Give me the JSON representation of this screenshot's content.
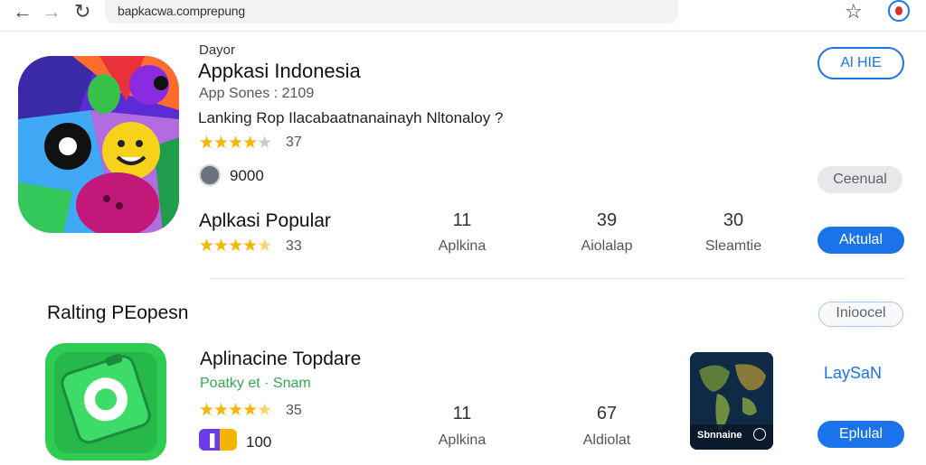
{
  "browser": {
    "url": "bapkacwa.comprepung",
    "back_icon": "arrow-left-icon",
    "forward_icon": "arrow-right-icon",
    "reload_icon": "reload-icon",
    "bookmark_icon": "star-icon"
  },
  "app1": {
    "developer": "Dayor",
    "name": "Appkasi Indonesia",
    "meta": "App Sones : 2109",
    "tagline": "Lanking Rop Ilacabaatnanainayh Nltonaloy ?",
    "rating_count": "37",
    "rating_stars": 3.5,
    "install_value": "9000",
    "action_top": "Al HIE",
    "action_secondary": "Ceenual"
  },
  "popular1": {
    "title": "Aplkasi Popular",
    "rating_count": "33",
    "rating_stars": 4.5,
    "stats": [
      {
        "value": "11",
        "label": "Aplkina"
      },
      {
        "value": "39",
        "label": "Aiolalap"
      },
      {
        "value": "30",
        "label": "Sleamtie"
      }
    ],
    "action": "Aktulal"
  },
  "section2": {
    "title": "Ralting PEopesn",
    "action": "Inioocel"
  },
  "app2": {
    "name": "Aplinacine Topdare",
    "meta": "Poatky et · Snam",
    "rating_count": "35",
    "rating_stars": 4.5,
    "install_value": "100",
    "stats": [
      {
        "value": "11",
        "label": "Aplkina"
      },
      {
        "value": "67",
        "label": "Aldiolat"
      }
    ],
    "thumb_caption": "Sbnnaine",
    "side_label": "LaySaN",
    "action": "Eplulal"
  },
  "colors": {
    "accent": "#1a73e8",
    "star": "#f4b400",
    "green_meta": "#34a853"
  }
}
